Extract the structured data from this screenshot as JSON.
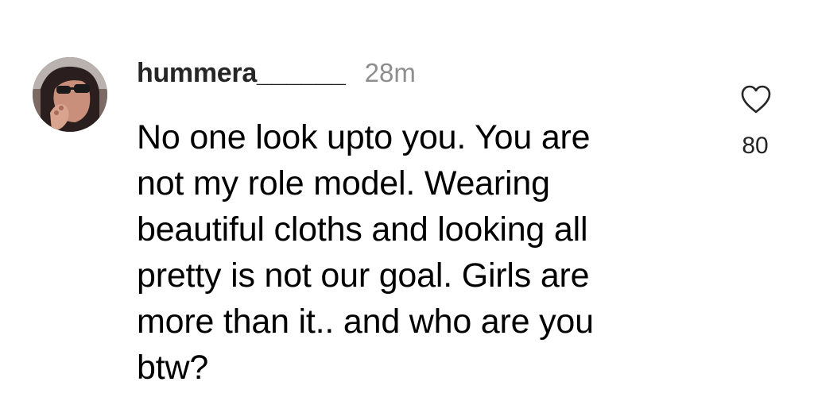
{
  "comment": {
    "username": "hummera______",
    "time_ago": "28m",
    "text": "No one look upto you. You are\nnot my role model. Wearing\nbeautiful cloths and looking all\npretty is not our goal. Girls are\nmore than it.. and who are you\nbtw?",
    "like_count": "80"
  },
  "icons": {
    "avatar": "profile-avatar",
    "like": "heart-outline-icon"
  },
  "colors": {
    "background": "#ffffff",
    "text": "#000000",
    "username": "#262626",
    "muted": "#8e8e8e"
  }
}
